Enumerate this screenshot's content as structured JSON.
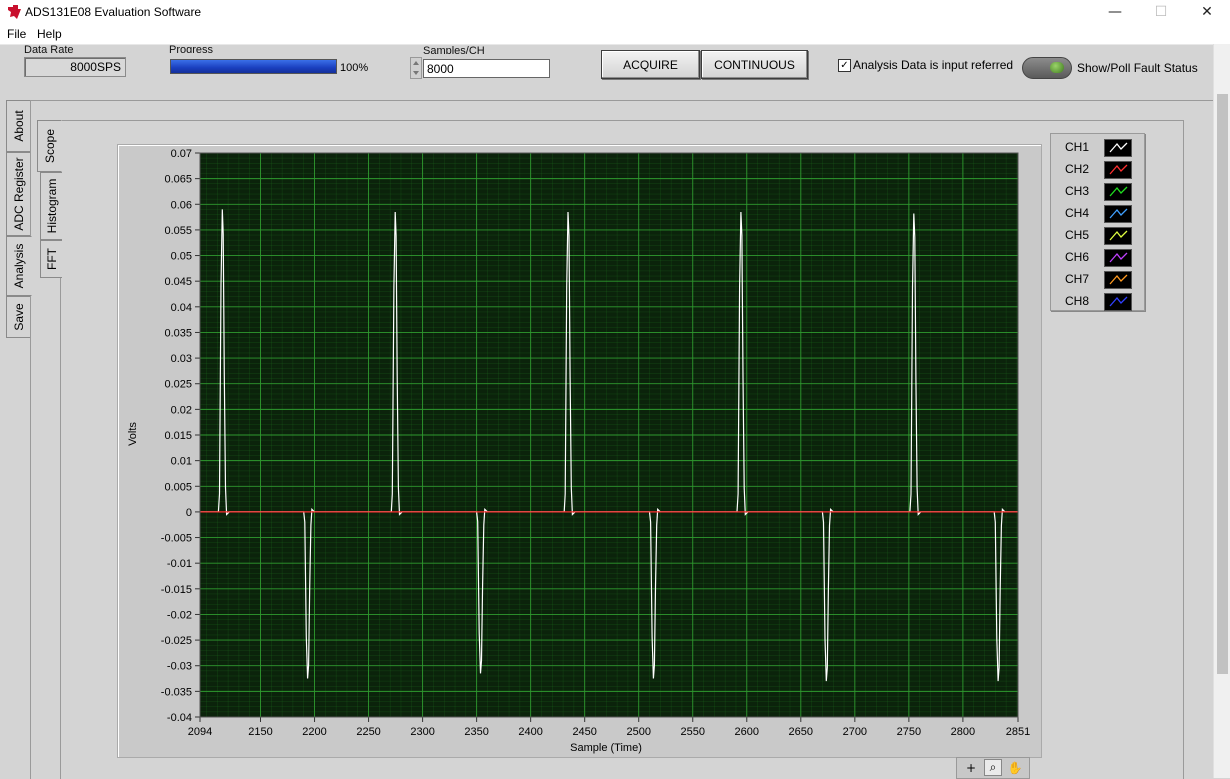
{
  "window": {
    "title": "ADS131E08 Evaluation Software",
    "controls": {
      "minimize": "—",
      "maximize": "☐",
      "close": "✕"
    }
  },
  "menu": [
    "File",
    "Help"
  ],
  "controls": {
    "data_rate": {
      "label": "Data Rate",
      "value": "8000SPS"
    },
    "progress": {
      "label": "Progress",
      "value": 1.0,
      "text": "100%"
    },
    "samples": {
      "label": "Samples/CH",
      "value": "8000"
    },
    "acquire_label": "ACQUIRE",
    "continuous_label": "CONTINUOUS",
    "analysis_checkbox": {
      "label": "Analysis Data is input referred",
      "checked": true
    },
    "fault": {
      "label": "Show/Poll Fault Status"
    }
  },
  "tabs_outer": [
    "About",
    "ADC Register",
    "Analysis",
    "Save"
  ],
  "tabs_inner": [
    "Scope",
    "Histogram",
    "FFT"
  ],
  "colors": {
    "plot_bg": "#0b230b",
    "grid": "#1f6e1f",
    "ch1": "#ffffff",
    "ch2": "#ff3030"
  },
  "legend": [
    {
      "name": "CH1",
      "color": "#ffffff"
    },
    {
      "name": "CH2",
      "color": "#ff3030"
    },
    {
      "name": "CH3",
      "color": "#20e020"
    },
    {
      "name": "CH4",
      "color": "#40a0ff"
    },
    {
      "name": "CH5",
      "color": "#e0ff40"
    },
    {
      "name": "CH6",
      "color": "#c040ff"
    },
    {
      "name": "CH7",
      "color": "#ff9a20"
    },
    {
      "name": "CH8",
      "color": "#3040ff"
    }
  ],
  "chart_data": {
    "type": "line",
    "xlabel": "Sample (Time)",
    "ylabel": "Volts",
    "xlim": [
      2094,
      2851
    ],
    "ylim": [
      -0.04,
      0.07
    ],
    "x_ticks": [
      "2094",
      "2150",
      "2200",
      "2250",
      "2300",
      "2350",
      "2400",
      "2450",
      "2500",
      "2550",
      "2600",
      "2650",
      "2700",
      "2750",
      "2800",
      "2851"
    ],
    "y_ticks": [
      "0.07",
      "0.065",
      "0.06",
      "0.055",
      "0.05",
      "0.045",
      "0.04",
      "0.035",
      "0.03",
      "0.025",
      "0.02",
      "0.015",
      "0.01",
      "0.005",
      "0",
      "-0.005",
      "-0.01",
      "-0.015",
      "-0.02",
      "-0.025",
      "-0.03",
      "-0.035",
      "-0.04"
    ],
    "grid": true,
    "series": [
      {
        "name": "CH1",
        "positive_peaks": [
          [
            2115,
            0.059
          ],
          [
            2275,
            0.0585
          ],
          [
            2435,
            0.0585
          ],
          [
            2595,
            0.0585
          ],
          [
            2755,
            0.0582
          ]
        ],
        "negative_peaks": [
          [
            2194,
            -0.0325
          ],
          [
            2354,
            -0.0315
          ],
          [
            2514,
            -0.0325
          ],
          [
            2674,
            -0.033
          ],
          [
            2833,
            -0.033
          ]
        ]
      },
      {
        "name": "CH2",
        "constant": 0
      }
    ]
  },
  "tools": [
    "+",
    "⌕",
    "✋"
  ]
}
